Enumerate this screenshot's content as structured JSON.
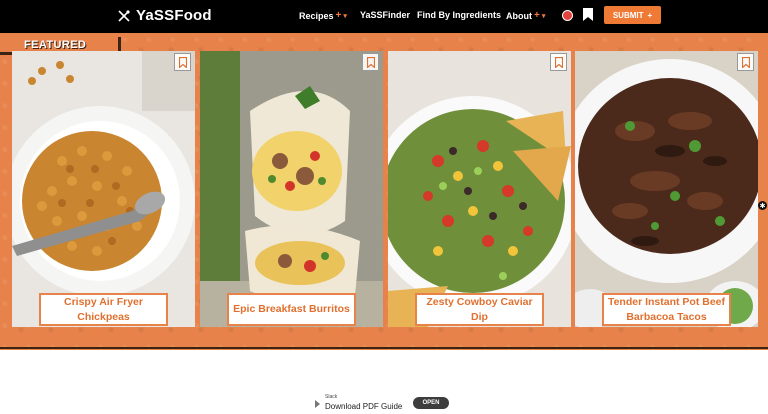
{
  "header": {
    "logo_text": "YaSSFood",
    "nav": [
      {
        "label": "Recipes",
        "plus": "+",
        "chevron": "▾"
      },
      {
        "label": "YaSSFinder"
      },
      {
        "label": "Find By Ingredients"
      },
      {
        "label": "About",
        "plus": "+",
        "chevron": "▾"
      }
    ],
    "submit_label": "SUBMIT",
    "submit_plus": "+"
  },
  "featured": {
    "tag": "FEATURED",
    "cards": [
      {
        "title": "Crispy Air Fryer Chickpeas"
      },
      {
        "title": "Epic Breakfast Burritos"
      },
      {
        "title": "Zesty Cowboy Caviar Dip"
      },
      {
        "title": "Tender Instant Pot Beef Barbacoa Tacos"
      }
    ]
  },
  "ad": {
    "brand": "Slack",
    "title": "Download PDF Guide",
    "button": "OPEN"
  },
  "colors": {
    "accent": "#ef7a35",
    "band": "#e6824a",
    "caption_text": "#e0702f",
    "header_bg": "#000000"
  }
}
